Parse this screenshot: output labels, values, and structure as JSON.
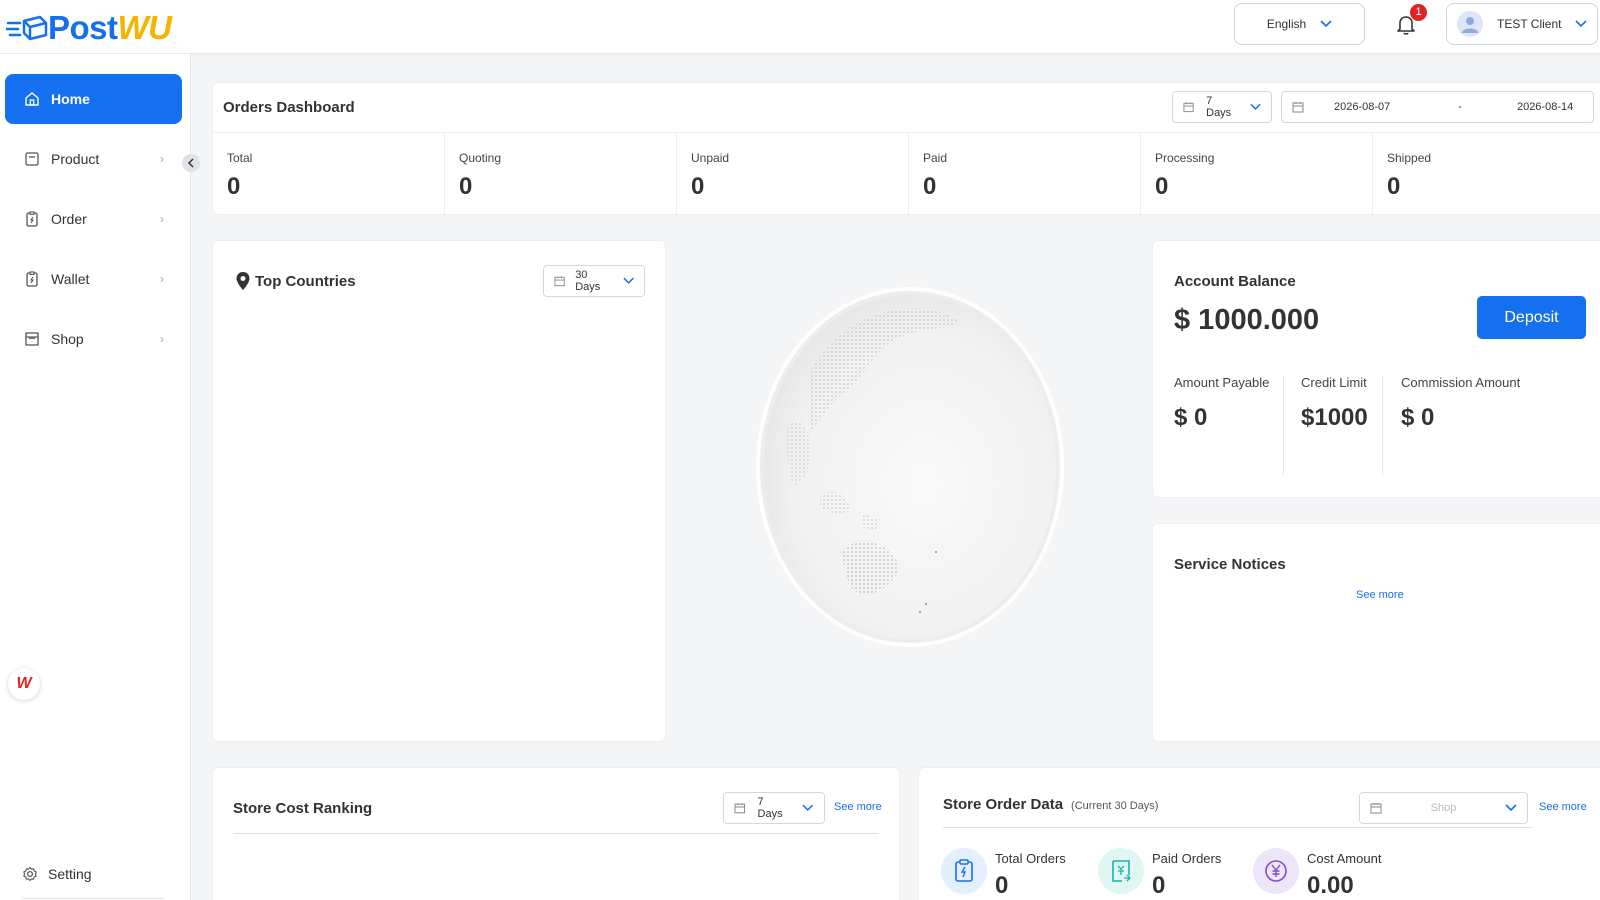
{
  "brand": {
    "part1": "Post",
    "part2": "WU"
  },
  "header": {
    "language": "English",
    "notification_count": "1",
    "user_name": "TEST Client"
  },
  "sidebar": {
    "items": [
      {
        "label": "Home",
        "icon": "home-icon",
        "active": true
      },
      {
        "label": "Product",
        "icon": "box-icon"
      },
      {
        "label": "Order",
        "icon": "order-icon"
      },
      {
        "label": "Wallet",
        "icon": "wallet-icon"
      },
      {
        "label": "Shop",
        "icon": "shop-icon"
      }
    ],
    "setting_label": "Setting"
  },
  "orders_dashboard": {
    "title": "Orders Dashboard",
    "range": "7 Days",
    "start_date": "2026-08-07",
    "separator": "-",
    "end_date": "2026-08-14",
    "stats": [
      {
        "label": "Total",
        "value": "0"
      },
      {
        "label": "Quoting",
        "value": "0"
      },
      {
        "label": "Unpaid",
        "value": "0"
      },
      {
        "label": "Paid",
        "value": "0"
      },
      {
        "label": "Processing",
        "value": "0"
      },
      {
        "label": "Shipped",
        "value": "0"
      }
    ]
  },
  "top_countries": {
    "title": "Top Countries",
    "range": "30 Days"
  },
  "account_balance": {
    "title": "Account Balance",
    "value": "$ 1000.000",
    "deposit_label": "Deposit",
    "amount_payable_label": "Amount Payable",
    "amount_payable_value": "$ 0",
    "credit_limit_label": "Credit Limit",
    "credit_limit_value": "$1000",
    "commission_label": "Commission Amount",
    "commission_value": "$ 0"
  },
  "service_notices": {
    "title": "Service Notices",
    "see_more": "See more"
  },
  "store_cost_ranking": {
    "title": "Store Cost Ranking",
    "range": "7 Days",
    "see_more": "See more"
  },
  "store_order_data": {
    "title": "Store Order Data",
    "subtitle": "(Current 30 Days)",
    "shop_placeholder": "Shop",
    "see_more": "See more",
    "metrics": [
      {
        "label": "Total Orders",
        "value": "0",
        "color": "#1570ef"
      },
      {
        "label": "Paid Orders",
        "value": "0",
        "color": "#18b5a8"
      },
      {
        "label": "Cost Amount",
        "value": "0.00",
        "color": "#7c4dcc"
      }
    ]
  },
  "colors": {
    "primary": "#1570ef",
    "brand_yellow": "#f5b400",
    "badge": "#e02424"
  }
}
